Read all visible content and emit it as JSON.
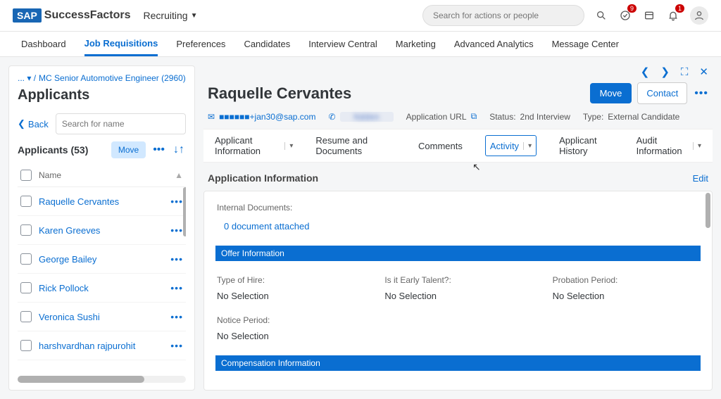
{
  "brand": {
    "sap": "SAP",
    "product": "SuccessFactors",
    "module": "Recruiting"
  },
  "global_search": {
    "placeholder": "Search for actions or people"
  },
  "notifications": {
    "todo_badge": "9",
    "bell_badge": "1"
  },
  "nav_tabs": [
    "Dashboard",
    "Job Requisitions",
    "Preferences",
    "Candidates",
    "Interview Central",
    "Marketing",
    "Advanced Analytics",
    "Message Center"
  ],
  "nav_active_index": 1,
  "sidebar": {
    "breadcrumb_prefix": "... ▾ /",
    "breadcrumb_item": "MC Senior Automotive Engineer (2960)",
    "breadcrumb_tail": "/",
    "title": "Applicants",
    "back_label": "Back",
    "search_placeholder": "Search for name",
    "count_label": "Applicants (53)",
    "move_label": "Move",
    "name_header": "Name",
    "rows": [
      {
        "name": "Raquelle Cervantes"
      },
      {
        "name": "Karen Greeves"
      },
      {
        "name": "George Bailey"
      },
      {
        "name": "Rick Pollock"
      },
      {
        "name": "Veronica Sushi"
      },
      {
        "name": "harshvardhan rajpurohit"
      }
    ]
  },
  "detail": {
    "candidate_name": "Raquelle Cervantes",
    "move_label": "Move",
    "contact_label": "Contact",
    "email_display": "■■■■■■+jan30@sap.com",
    "app_url_label": "Application URL",
    "status_label": "Status:",
    "status_value": "2nd Interview",
    "type_label": "Type:",
    "type_value": "External Candidate",
    "subtabs": [
      {
        "label": "Applicant Information",
        "has_dd": true
      },
      {
        "label": "Resume and Documents",
        "has_dd": false
      },
      {
        "label": "Comments",
        "has_dd": false
      },
      {
        "label": "Activity",
        "has_dd": true
      },
      {
        "label": "Applicant History",
        "has_dd": false
      },
      {
        "label": "Audit Information",
        "has_dd": true
      }
    ],
    "subtab_active_index": 3,
    "section_title": "Application Information",
    "edit_label": "Edit",
    "internal_docs_label": "Internal Documents:",
    "docs_attached": "0 document attached",
    "offer_bar": "Offer Information",
    "comp_bar": "Compensation Information",
    "offer_fields": {
      "type_of_hire_lbl": "Type of Hire:",
      "type_of_hire_val": "No Selection",
      "early_talent_lbl": "Is it Early Talent?:",
      "early_talent_val": "No Selection",
      "probation_lbl": "Probation Period:",
      "probation_val": "No Selection",
      "notice_lbl": "Notice Period:",
      "notice_val": "No Selection"
    }
  }
}
